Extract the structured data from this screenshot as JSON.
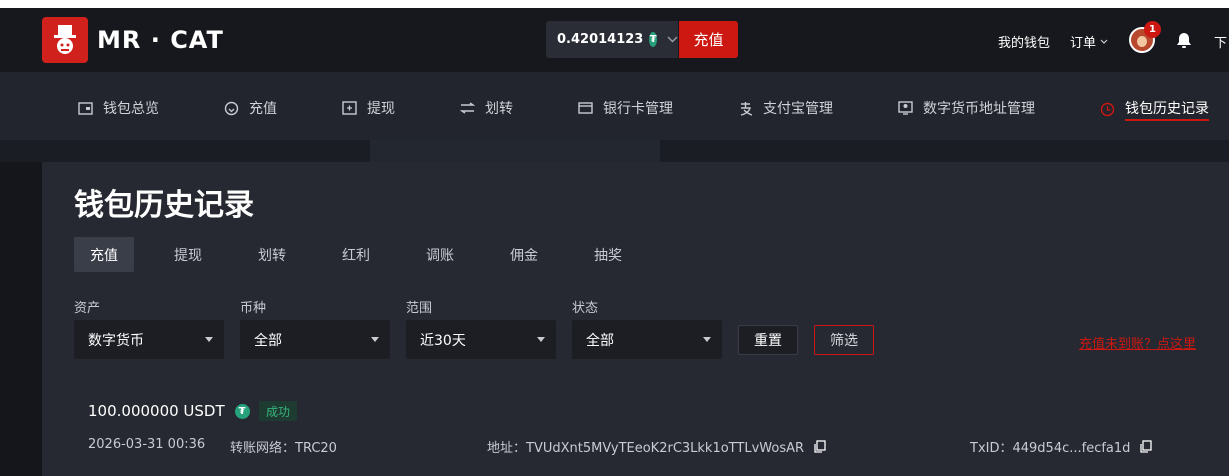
{
  "header": {
    "brand": "MR · CAT",
    "balance": "0.42014123",
    "deposit_label": "充值",
    "wallet_link": "我的钱包",
    "orders_link": "订单",
    "notification_count": "1",
    "cut_off_link": "下"
  },
  "nav": {
    "items": [
      {
        "label": "钱包总览",
        "icon": "wallet-icon"
      },
      {
        "label": "充值",
        "icon": "deposit-icon"
      },
      {
        "label": "提现",
        "icon": "withdraw-icon"
      },
      {
        "label": "划转",
        "icon": "transfer-icon"
      },
      {
        "label": "银行卡管理",
        "icon": "bank-card-icon"
      },
      {
        "label": "支付宝管理",
        "icon": "alipay-icon"
      },
      {
        "label": "数字货币地址管理",
        "icon": "crypto-address-icon"
      },
      {
        "label": "钱包历史记录",
        "icon": "history-icon"
      }
    ],
    "active_index": 7
  },
  "page": {
    "title": "钱包历史记录",
    "tabs": [
      "充值",
      "提现",
      "划转",
      "红利",
      "调账",
      "佣金",
      "抽奖"
    ],
    "active_tab": 0
  },
  "filters": {
    "asset": {
      "label": "资产",
      "value": "数字货币"
    },
    "currency": {
      "label": "币种",
      "value": "全部"
    },
    "range": {
      "label": "范围",
      "value": "近30天"
    },
    "status": {
      "label": "状态",
      "value": "全部"
    },
    "reset_label": "重置",
    "filter_label": "筛选",
    "help_link": "充值未到账？点这里"
  },
  "records": [
    {
      "amount": "100.000000 USDT",
      "status": "成功",
      "time": "2026-03-31 00:36",
      "network": "转账网络：TRC20",
      "address": "地址：TVUdXnt5MVyTEeoK2rC3Lkk1oTTLvWosAR",
      "txid": "TxID：449d54c...fecfa1d"
    }
  ],
  "colors": {
    "accent": "#cc1811",
    "tether": "#26a17b",
    "success": "#36b37e"
  }
}
